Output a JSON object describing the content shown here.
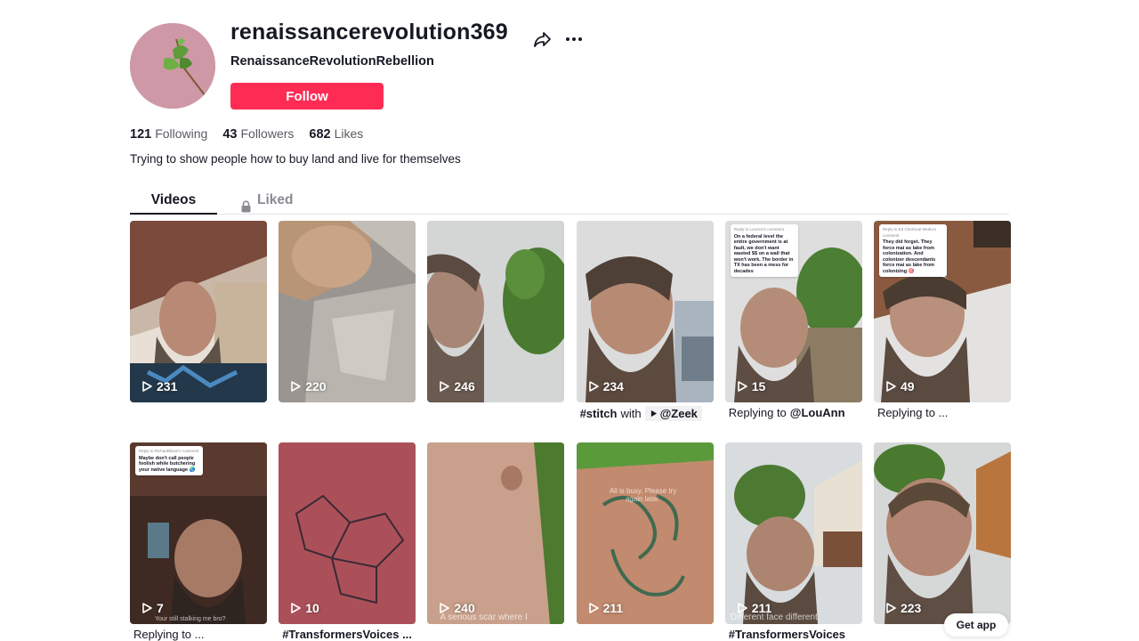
{
  "profile": {
    "username": "renaissancerevolution369",
    "nickname": "RenaissanceRevolutionRebellion",
    "follow_label": "Follow",
    "bio": "Trying to show people how to buy land and live for themselves",
    "stats": [
      {
        "value": "121",
        "label": "Following"
      },
      {
        "value": "43",
        "label": "Followers"
      },
      {
        "value": "682",
        "label": "Likes"
      }
    ]
  },
  "tabs": {
    "videos": "Videos",
    "liked": "Liked"
  },
  "videos": [
    {
      "views": "231",
      "caption": ""
    },
    {
      "views": "220",
      "caption": ""
    },
    {
      "views": "246",
      "caption": ""
    },
    {
      "views": "234",
      "caption_tag": "#stitch",
      "caption_mid": "with",
      "caption_mention": "@Zeek"
    },
    {
      "views": "15",
      "caption_prefix": "Replying to",
      "caption_mention": "@LouAnn",
      "bubble_header": "Reply to LouAnn's comment",
      "bubble_text": "On a federal level the entire government is at fault, we don't want wasted $$ on a wall that won't work. The border in TX has been a mess for decades"
    },
    {
      "views": "49",
      "caption_prefix": "Replying to ...",
      "bubble_header": "Reply to Ed Chemical Media's comment",
      "bubble_text": "They did forget. They force mai as lake from colonization. And colonizer descendants force mai as lake from colonizing 🎯"
    },
    {
      "views": "7",
      "caption_prefix": "Replying to ...",
      "bubble_header": "Reply to RichardBlaze's comment",
      "bubble_text": "Maybe don't call people foolish while butchering your native language 🌏",
      "overlay": "Your still stalking me bro?"
    },
    {
      "views": "10",
      "caption_tag": "#TransformersVoices ..."
    },
    {
      "views": "240",
      "overlay": "A serious scar where I"
    },
    {
      "views": "211",
      "overlay_top": "All is busy. Please try again later."
    },
    {
      "views": "211",
      "caption_tag": "#TransformersVoices",
      "overlay": "Different face different"
    },
    {
      "views": "223"
    }
  ],
  "get_app_label": "Get app",
  "colors": {
    "accent": "#fe2c55",
    "text": "#161823",
    "muted": "#5a5b63"
  }
}
